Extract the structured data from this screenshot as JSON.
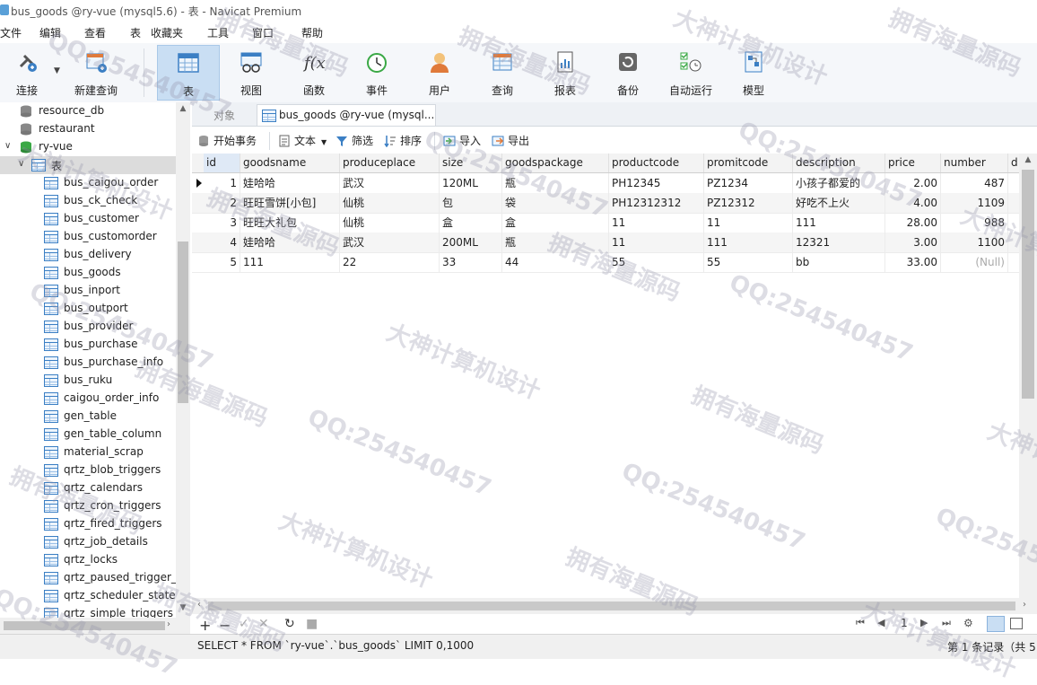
{
  "window": {
    "title": "bus_goods @ry-vue (mysql5.6) - 表 - Navicat Premium"
  },
  "menu": [
    "文件",
    "编辑",
    "查看",
    "表",
    "收藏夹",
    "工具",
    "窗口",
    "帮助"
  ],
  "toolbar": {
    "connect": "连接",
    "new_query": "新建查询",
    "table": "表",
    "view": "视图",
    "function": "函数",
    "event": "事件",
    "user": "用户",
    "query": "查询",
    "report": "报表",
    "backup": "备份",
    "autorun": "自动运行",
    "model": "模型"
  },
  "sidebar": {
    "databases": [
      "resource_db",
      "restaurant",
      "ry-vue"
    ],
    "tables_folder": "表",
    "tables": [
      "bus_caigou_order",
      "bus_ck_check",
      "bus_customer",
      "bus_customorder",
      "bus_delivery",
      "bus_goods",
      "bus_inport",
      "bus_outport",
      "bus_provider",
      "bus_purchase",
      "bus_purchase_info",
      "bus_ruku",
      "caigou_order_info",
      "gen_table",
      "gen_table_column",
      "material_scrap",
      "qrtz_blob_triggers",
      "qrtz_calendars",
      "qrtz_cron_triggers",
      "qrtz_fired_triggers",
      "qrtz_job_details",
      "qrtz_locks",
      "qrtz_paused_trigger_g",
      "qrtz_scheduler_state",
      "qrtz_simple_triggers"
    ]
  },
  "tabs": {
    "objects": "对象",
    "active": "bus_goods @ry-vue (mysql..."
  },
  "grid_toolbar": {
    "begin_tx": "开始事务",
    "text": "文本",
    "filter": "筛选",
    "sort": "排序",
    "import": "导入",
    "export": "导出"
  },
  "table": {
    "columns": [
      "id",
      "goodsname",
      "produceplace",
      "size",
      "goodspackage",
      "productcode",
      "promitcode",
      "description",
      "price",
      "number",
      "d"
    ],
    "rows": [
      [
        "1",
        "娃哈哈",
        "武汉",
        "120ML",
        "瓶",
        "PH12345",
        "PZ1234",
        "小孩子都爱的",
        "2.00",
        "487"
      ],
      [
        "2",
        "旺旺雪饼[小包]",
        "仙桃",
        "包",
        "袋",
        "PH12312312",
        "PZ12312",
        "好吃不上火",
        "4.00",
        "1109"
      ],
      [
        "3",
        "旺旺大礼包",
        "仙桃",
        "盒",
        "盒",
        "11",
        "11",
        "111",
        "28.00",
        "988"
      ],
      [
        "4",
        "娃哈哈",
        "武汉",
        "200ML",
        "瓶",
        "11",
        "111",
        "12321",
        "3.00",
        "1100"
      ],
      [
        "5",
        "111",
        "22",
        "33",
        "44",
        "55",
        "55",
        "bb",
        "33.00",
        "(Null)"
      ]
    ]
  },
  "nav": {
    "page": "1"
  },
  "status": {
    "sql": "SELECT * FROM `ry-vue`.`bus_goods` LIMIT 0,1000",
    "records": "第 1 条记录（共 5"
  },
  "watermarks": [
    "大神计算机设计",
    "QQ:254540457",
    "拥有海量源码"
  ],
  "colors": {
    "toolbar_active": "#c9def3",
    "table_icon": "#3b7fc4",
    "db_icon_green": "#3aa845"
  }
}
